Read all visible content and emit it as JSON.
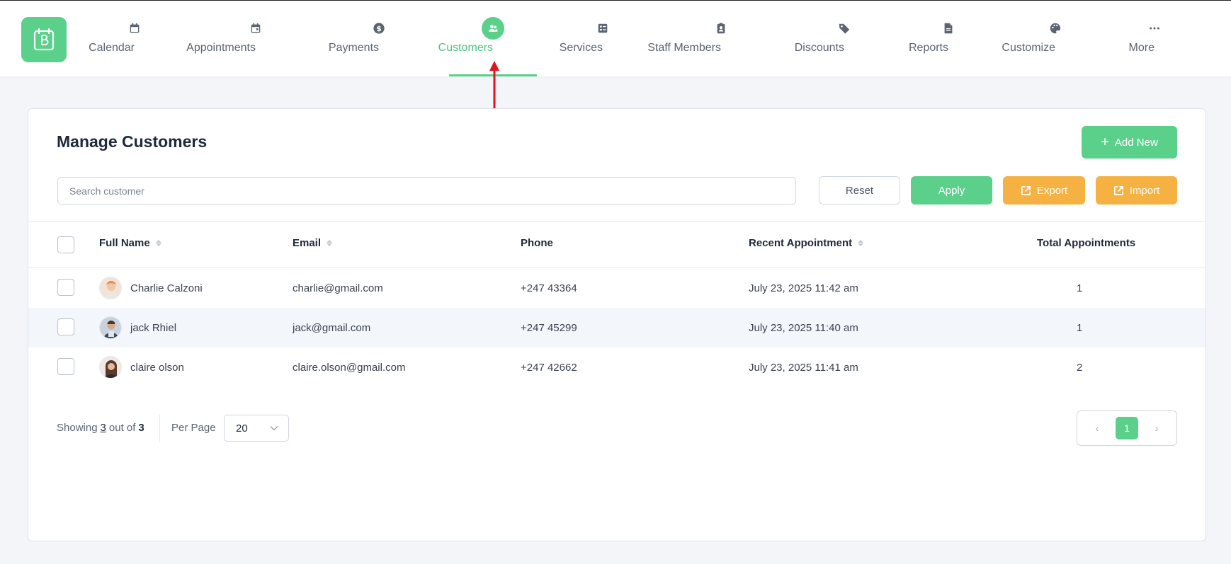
{
  "nav": {
    "items": [
      {
        "label": "Calendar",
        "icon": "calendar-icon"
      },
      {
        "label": "Appointments",
        "icon": "calendar-check-icon"
      },
      {
        "label": "Payments",
        "icon": "dollar-icon"
      },
      {
        "label": "Customers",
        "icon": "users-icon",
        "active": true
      },
      {
        "label": "Services",
        "icon": "checklist-icon"
      },
      {
        "label": "Staff Members",
        "icon": "clipboard-user-icon"
      },
      {
        "label": "Discounts",
        "icon": "tag-icon"
      },
      {
        "label": "Reports",
        "icon": "file-icon"
      },
      {
        "label": "Customize",
        "icon": "palette-icon"
      },
      {
        "label": "More",
        "icon": "more-dots-icon"
      }
    ]
  },
  "page": {
    "title": "Manage Customers",
    "add_new_label": "Add New"
  },
  "filters": {
    "search_placeholder": "Search customer",
    "search_value": "",
    "reset_label": "Reset",
    "apply_label": "Apply",
    "export_label": "Export",
    "import_label": "Import"
  },
  "table": {
    "columns": {
      "full_name": "Full Name",
      "email": "Email",
      "phone": "Phone",
      "recent_appointment": "Recent Appointment",
      "total_appointments": "Total Appointments"
    },
    "rows": [
      {
        "name": "Charlie Calzoni",
        "email": "charlie@gmail.com",
        "phone": "+247 43364",
        "recent": "July 23, 2025 11:42 am",
        "total": "1"
      },
      {
        "name": "jack Rhiel",
        "email": "jack@gmail.com",
        "phone": "+247 45299",
        "recent": "July 23, 2025 11:40 am",
        "total": "1"
      },
      {
        "name": "claire olson",
        "email": "claire.olson@gmail.com",
        "phone": "+247 42662",
        "recent": "July 23, 2025 11:41 am",
        "total": "2"
      }
    ]
  },
  "footer": {
    "showing_prefix": "Showing",
    "showing_count": "3",
    "showing_mid": "out of",
    "showing_total": "3",
    "per_page_label": "Per Page",
    "per_page_value": "20",
    "current_page": "1",
    "prev_label": "‹",
    "next_label": "›"
  },
  "colors": {
    "accent": "#5ad08a",
    "warning": "#f5b142",
    "annotation_arrow": "#e0141e"
  }
}
